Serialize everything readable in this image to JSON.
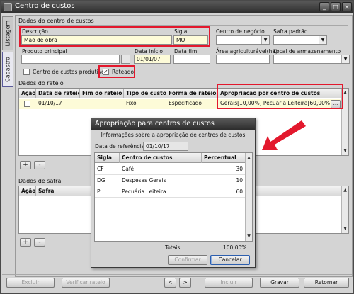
{
  "window": {
    "title": "Centro de custos"
  },
  "side_tabs": {
    "listagem": "Listagem",
    "cadastro": "Cadastro"
  },
  "header_section": {
    "title": "Dados do centro de custos",
    "descricao_label": "Descrição",
    "descricao_value": "Mão de obra",
    "sigla_label": "Sigla",
    "sigla_value": "MO",
    "centro_negocio_label": "Centro de negócio",
    "safra_padrao_label": "Safra padrão",
    "produto_principal_label": "Produto principal",
    "data_inicio_label": "Data início",
    "data_inicio_value": "01/01/07",
    "data_fim_label": "Data fim",
    "area_label": "Área agriculturável(ha)",
    "local_label": "Local de armazenamento",
    "produtivo_label": "Centro de custos produtivo",
    "rateado_label": "Rateado"
  },
  "rateio": {
    "title": "Dados do rateio",
    "columns": [
      "Ação",
      "Data de rateio",
      "Fim do rateio",
      "Tipo de custo",
      "Forma de rateio",
      "Apropriacao por centro de custos"
    ],
    "row": {
      "data": "01/10/17",
      "fim": "",
      "tipo": "Fixo",
      "forma": "Especificado",
      "apropriacao": "Gerais[10,00%]  Pecuária  Leiteira[60,00%]",
      "more": "..."
    }
  },
  "safra": {
    "title": "Dados de safra",
    "columns": [
      "Ação",
      "Safra"
    ]
  },
  "grid_buttons": {
    "add": "+",
    "remove": "-"
  },
  "bottom_bar": {
    "excluir": "Excluir",
    "verificar": "Verificar rateio",
    "prev": "<",
    "next": ">",
    "incluir": "Incluir",
    "gravar": "Gravar",
    "retornar": "Retornar"
  },
  "dialog": {
    "title": "Apropriação para centros de custos",
    "subtitle": "Informações sobre a apropriação de centros de custos",
    "ref_label": "Data de referência",
    "ref_value": "01/10/17",
    "columns": [
      "Sigla",
      "Centro de custos",
      "Percentual"
    ],
    "rows": [
      {
        "sigla": "CF",
        "centro": "Café",
        "percentual": "30"
      },
      {
        "sigla": "DG",
        "centro": "Despesas Gerais",
        "percentual": "10"
      },
      {
        "sigla": "PL",
        "centro": "Pecuária Leiteira",
        "percentual": "60"
      }
    ],
    "totais_label": "Totais:",
    "totais_value": "100,00%",
    "confirmar": "Confirmar",
    "cancelar": "Cancelar"
  },
  "colors": {
    "highlight": "#e3182d",
    "titlebar": "#3a3a3a",
    "yellow_field": "#fdfbd8"
  }
}
